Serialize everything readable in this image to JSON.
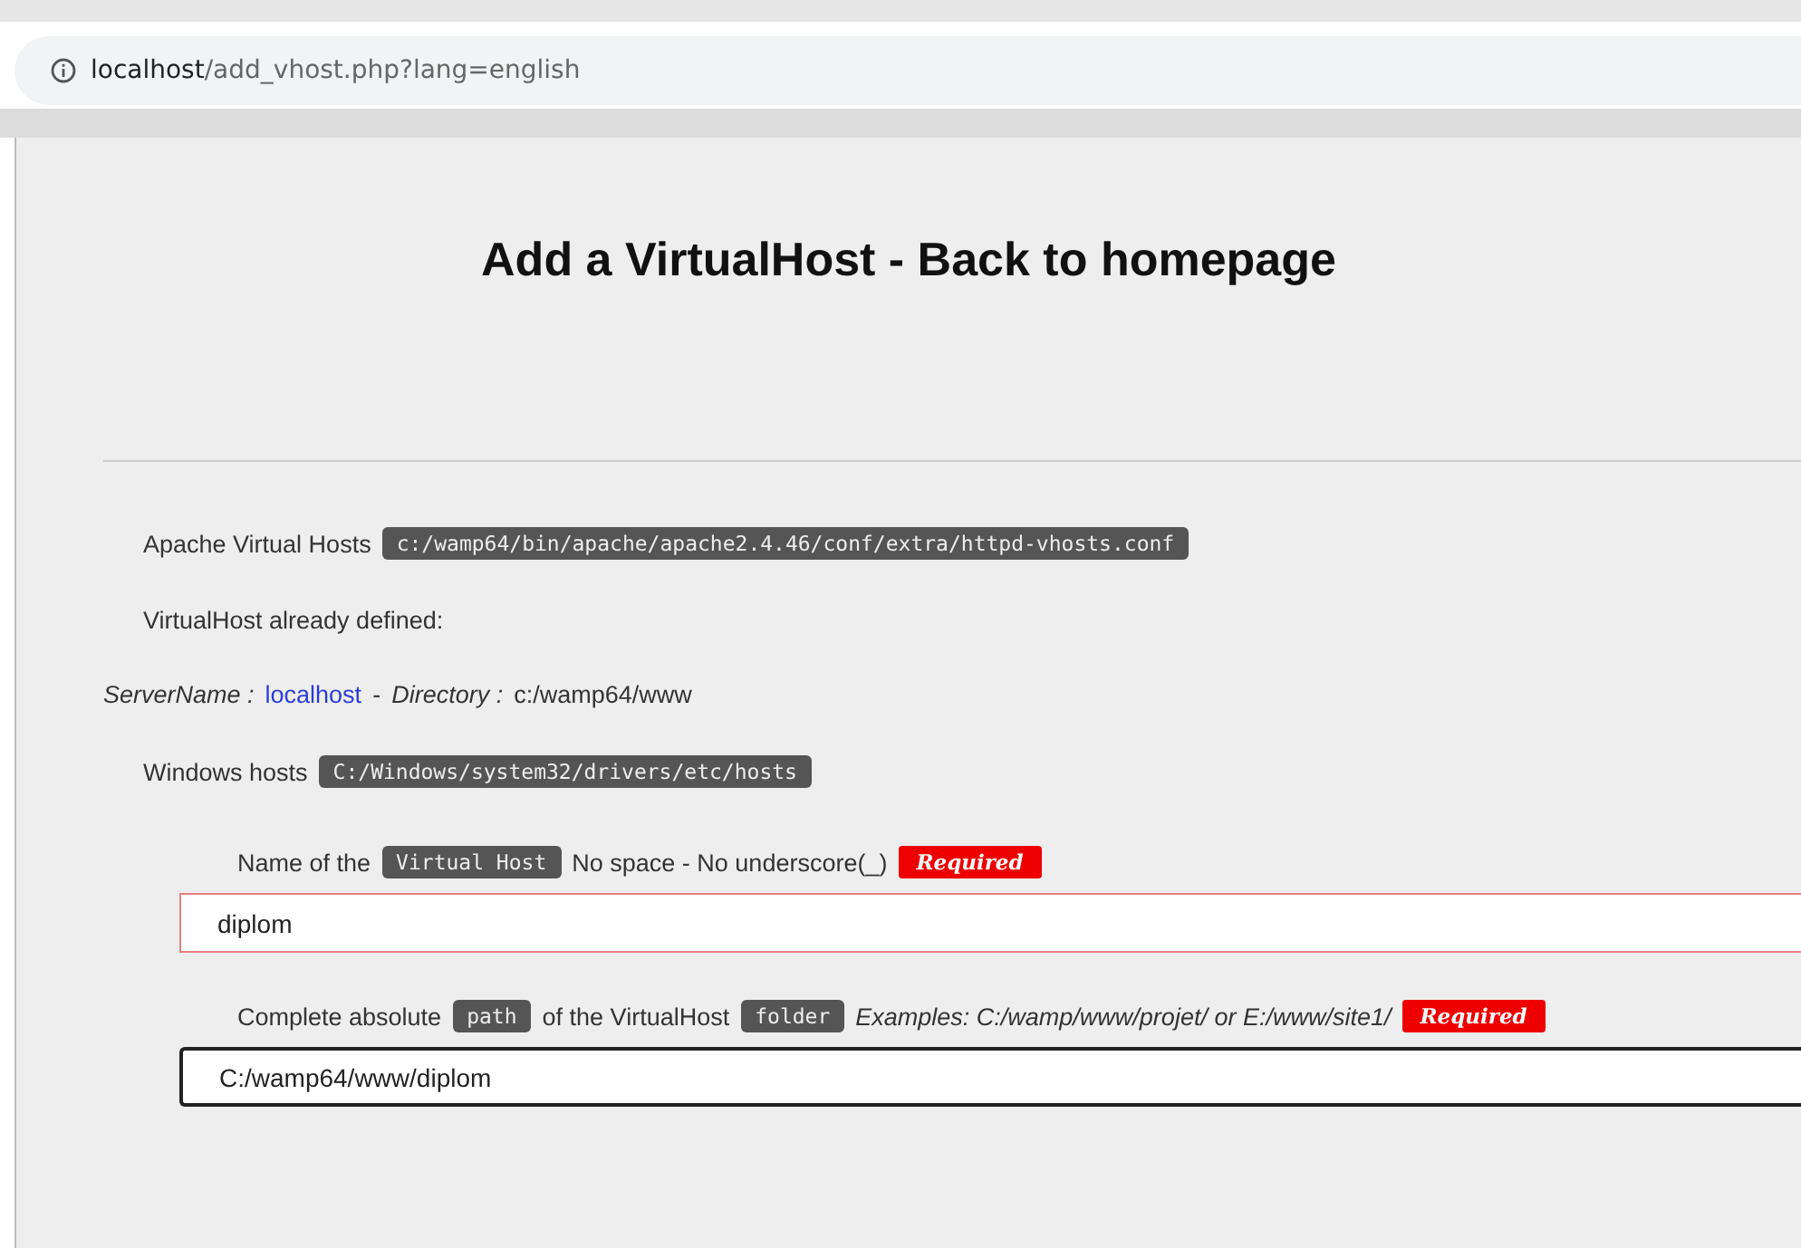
{
  "address_bar": {
    "host": "localhost",
    "path": "/add_vhost.php?lang=english"
  },
  "title": "Add a VirtualHost - Back to homepage",
  "info_lines": [
    {
      "indent": true,
      "segments": [
        {
          "kind": "text",
          "text": "Apache Virtual Hosts"
        },
        {
          "kind": "code",
          "text": "c:/wamp64/bin/apache/apache2.4.46/conf/extra/httpd-vhosts.conf"
        }
      ]
    },
    {
      "indent": true,
      "segments": [
        {
          "kind": "text",
          "text": "VirtualHost already defined:"
        }
      ]
    },
    {
      "indent": false,
      "segments": [
        {
          "kind": "italic",
          "text": "ServerName :"
        },
        {
          "kind": "link",
          "text": "localhost"
        },
        {
          "kind": "text",
          "text": "-"
        },
        {
          "kind": "italic",
          "text": "Directory :"
        },
        {
          "kind": "text",
          "text": "c:/wamp64/www"
        }
      ]
    },
    {
      "indent": true,
      "segments": [
        {
          "kind": "text",
          "text": "Windows hosts"
        },
        {
          "kind": "code",
          "text": "C:/Windows/system32/drivers/etc/hosts"
        }
      ]
    }
  ],
  "form_fields": [
    {
      "label": [
        {
          "kind": "text",
          "text": "Name of the"
        },
        {
          "kind": "code",
          "text": "Virtual Host"
        },
        {
          "kind": "text",
          "text": "No space - No underscore(_)"
        },
        {
          "kind": "required",
          "text": "Required"
        }
      ],
      "value": "diplom",
      "invalid": true,
      "focused": false
    },
    {
      "label": [
        {
          "kind": "text",
          "text": "Complete absolute"
        },
        {
          "kind": "code",
          "text": "path"
        },
        {
          "kind": "text",
          "text": "of the VirtualHost"
        },
        {
          "kind": "code",
          "text": "folder"
        },
        {
          "kind": "italic",
          "text": "Examples: C:/wamp/www/projet/ or E:/www/site1/"
        },
        {
          "kind": "required",
          "text": "Required"
        }
      ],
      "value": "C:/wamp64/www/diplom",
      "invalid": false,
      "focused": true
    }
  ]
}
